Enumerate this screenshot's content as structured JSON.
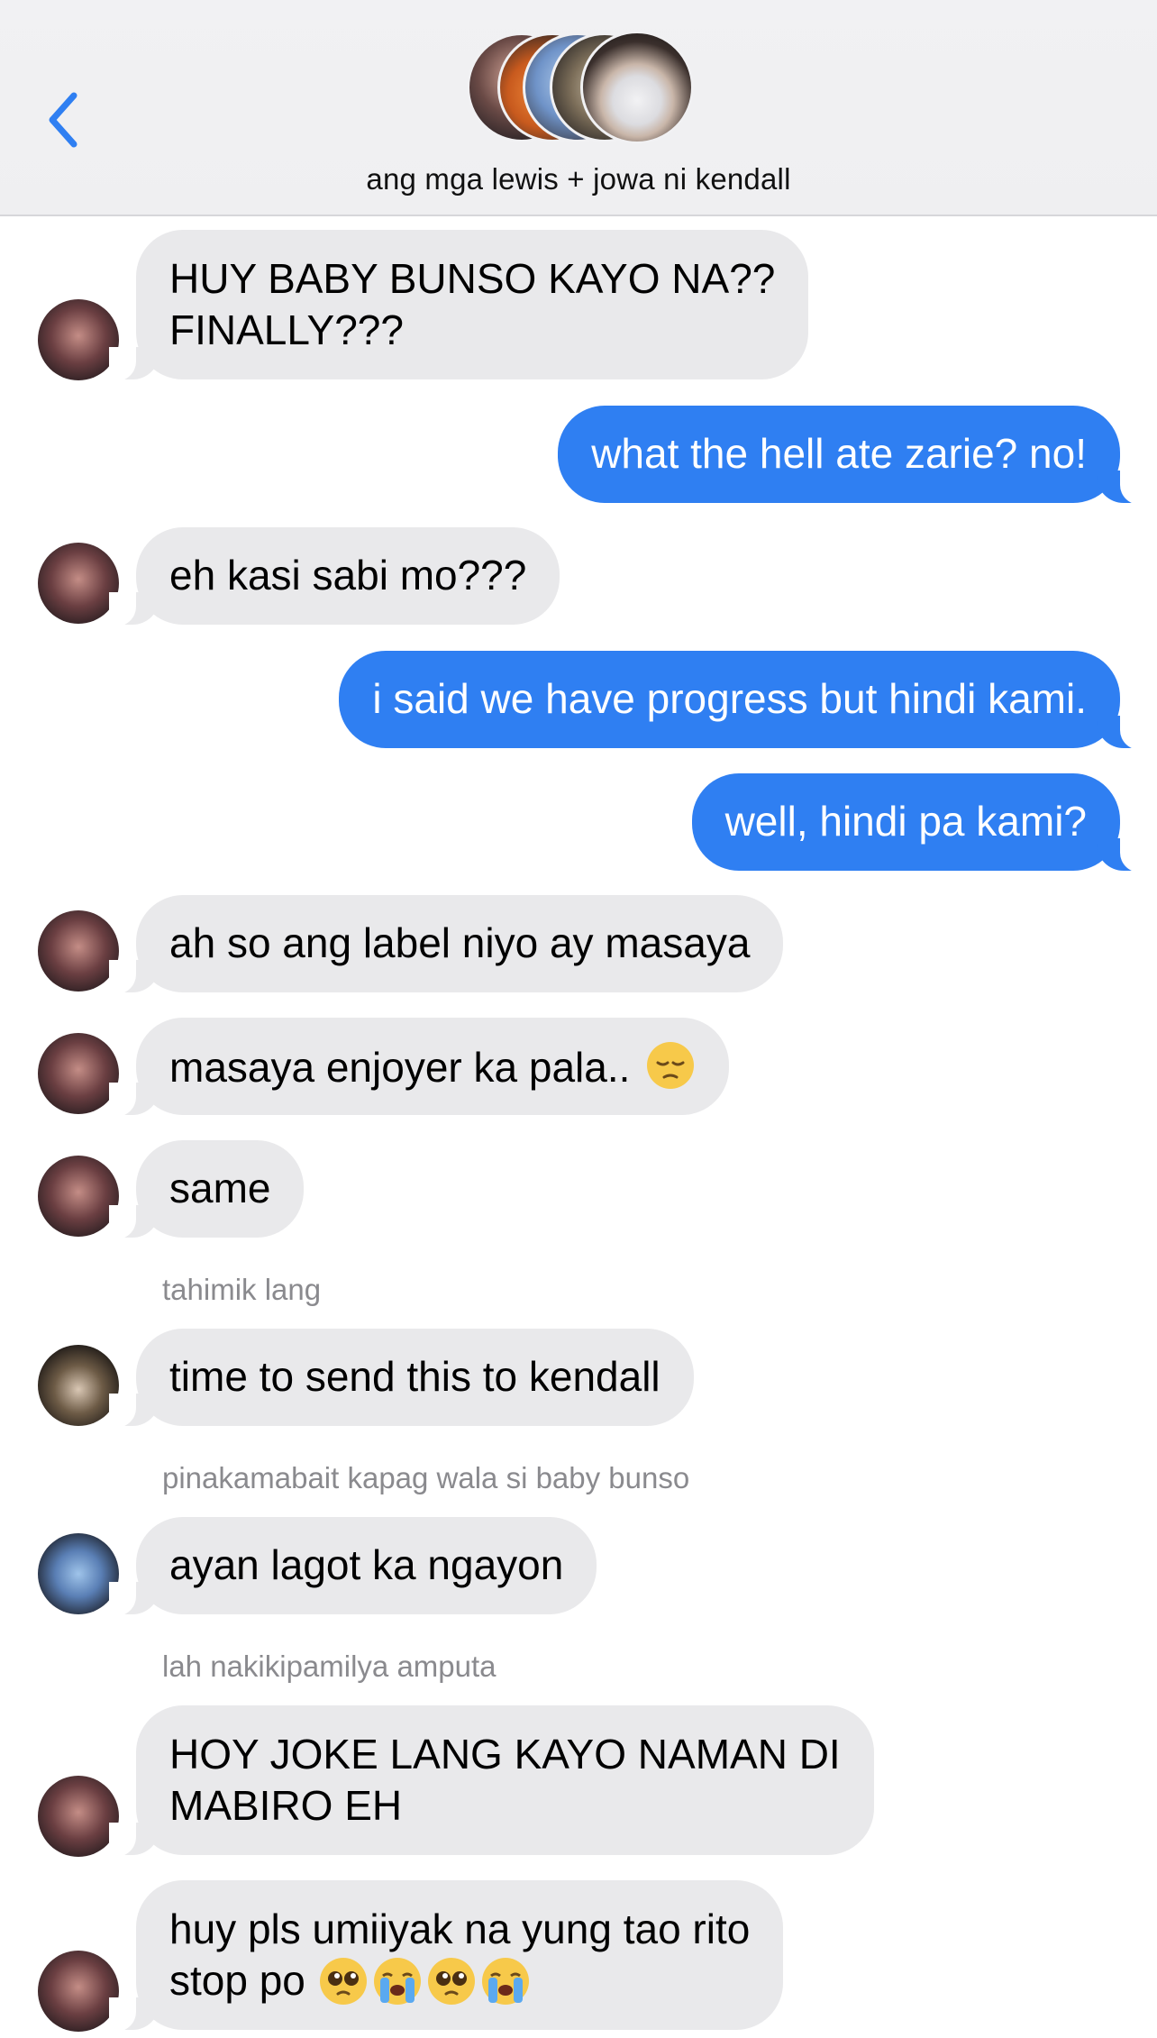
{
  "header": {
    "group_name": "ang mga lewis + jowa ni kendall",
    "back_icon": "chevron-left-icon"
  },
  "colors": {
    "accent": "#2f7ff2",
    "received_bubble": "#e9e9eb",
    "header_bg": "#f1f1f3",
    "sender_label": "#8a8a8e"
  },
  "messages": [
    {
      "direction": "received",
      "text_lines": [
        "HUY BABY BUNSO KAYO NA??",
        "FINALLY???"
      ]
    },
    {
      "direction": "sent",
      "text": "what the hell ate zarie? no!"
    },
    {
      "direction": "received",
      "text": "eh kasi sabi mo???"
    },
    {
      "direction": "sent",
      "text": "i said we have progress but hindi kami."
    },
    {
      "direction": "sent",
      "text": "well, hindi pa kami?"
    },
    {
      "direction": "received",
      "text": "ah so ang label niyo ay masaya"
    },
    {
      "direction": "received",
      "text": "masaya enjoyer ka pala..",
      "emojis": [
        "pensive-face-emoji"
      ]
    },
    {
      "direction": "received",
      "text": "same"
    },
    {
      "direction": "received",
      "sender": "tahimik lang",
      "text": "time to send this to kendall"
    },
    {
      "direction": "received",
      "sender": "pinakamabait kapag wala si baby bunso",
      "text": "ayan lagot ka ngayon"
    },
    {
      "direction": "received",
      "sender": "lah nakikipamilya amputa",
      "text_lines": [
        "HOY JOKE LANG KAYO NAMAN DI",
        "MABIRO EH"
      ]
    },
    {
      "direction": "received",
      "text_lines": [
        "huy pls umiiyak na yung tao rito",
        "stop po"
      ],
      "emojis": [
        "pleading-face-emoji",
        "loudly-crying-face-emoji",
        "pleading-face-emoji",
        "loudly-crying-face-emoji"
      ]
    }
  ]
}
